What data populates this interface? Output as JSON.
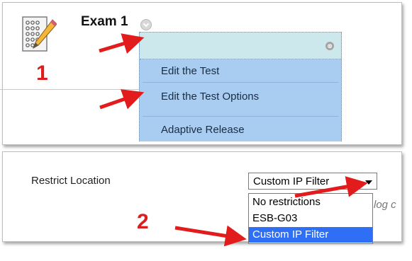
{
  "panel1": {
    "title": "Exam 1",
    "step_number": "1",
    "menu": {
      "items": [
        "Edit the Test",
        "Edit the Test Options",
        "Adaptive Release"
      ],
      "close_glyph": "⊗"
    }
  },
  "panel2": {
    "label": "Restrict Location",
    "select_value": "Custom IP Filter",
    "options": [
      "No restrictions",
      "ESB-G03",
      "Custom IP Filter"
    ],
    "selected_option": "Custom IP Filter",
    "behind_text": "log c",
    "step_number": "2"
  },
  "colors": {
    "arrow": "#e21c1c",
    "menu_bg": "#a9cdf1",
    "menu_head": "#cde8ec",
    "highlight": "#2f6ff6"
  },
  "icons": [
    "test-sheet-pencil-icon",
    "chevron-down-icon",
    "close-icon",
    "dropdown-caret-icon",
    "annotation-arrow-icon"
  ]
}
